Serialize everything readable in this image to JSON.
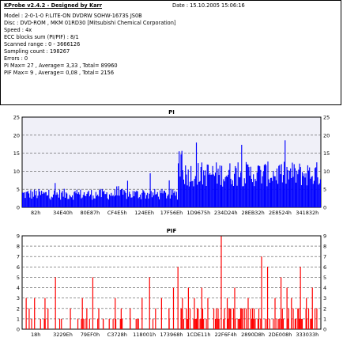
{
  "header": {
    "title": "KProbe v2.4.2 - Designed by Karr",
    "date": "Date : 15.10.2005 15:06:16",
    "lines": [
      "Model : 2-0-1-0 F:LITE-ON DVDRW SOHW-1673S JS0B",
      "Disc : DVD-ROM , MKM 01RD30  [Mitsubishi Chemical Corporation]",
      "Speed : 4x",
      "ECC blocks sum (PI/PIF) : 8/1",
      "Scanned range : 0 - 3666126",
      "Sampling count : 198267",
      "Errors : 0",
      "PI Max= 27 , Average= 3,33 , Total= 89960",
      "PIF Max= 9 , Average= 0,08 , Total= 2156"
    ]
  },
  "chart_data": [
    {
      "type": "bar",
      "title": "PI",
      "color": "#0000ff",
      "background": "#f0f0f8",
      "ylim": [
        0,
        25
      ],
      "y_ticks": [
        0,
        5,
        10,
        15,
        20,
        25
      ],
      "x_tick_labels": [
        "82h",
        "34E40h",
        "80E87h",
        "CF4E5h",
        "124EEh",
        "17F56Eh",
        "1D9675h",
        "234D24h",
        "28EB32h",
        "2E8524h",
        "341832h"
      ],
      "grid": true,
      "max": 27,
      "average": 3.33,
      "profile": [
        {
          "from": 0.0,
          "to": 0.52,
          "baseline": 3.3,
          "spread": 2.2,
          "peak": 9.5
        },
        {
          "from": 0.52,
          "to": 0.54,
          "baseline": 12,
          "spread": 10,
          "peak": 27
        },
        {
          "from": 0.54,
          "to": 1.0,
          "baseline": 8.5,
          "spread": 5,
          "peak": 19
        }
      ]
    },
    {
      "type": "bar",
      "title": "PIF",
      "color": "#ff0000",
      "background": "#ffffff",
      "ylim": [
        0,
        9
      ],
      "y_ticks": [
        0,
        1,
        2,
        3,
        4,
        5,
        6,
        7,
        8,
        9
      ],
      "x_tick_labels": [
        "18h",
        "3229Eh",
        "79EF0h",
        "C3728h",
        "118001h",
        "173968h",
        "1CDE11h",
        "22F6F4h",
        "2890D8h",
        "2DE008h",
        "333033h"
      ],
      "grid": true,
      "max": 9,
      "average": 0.08,
      "spikes": [
        {
          "pos": 0.012,
          "v": 3
        },
        {
          "pos": 0.022,
          "v": 2
        },
        {
          "pos": 0.04,
          "v": 3
        },
        {
          "pos": 0.06,
          "v": 1
        },
        {
          "pos": 0.075,
          "v": 3
        },
        {
          "pos": 0.085,
          "v": 2
        },
        {
          "pos": 0.11,
          "v": 5
        },
        {
          "pos": 0.13,
          "v": 1
        },
        {
          "pos": 0.16,
          "v": 2
        },
        {
          "pos": 0.185,
          "v": 1
        },
        {
          "pos": 0.2,
          "v": 3
        },
        {
          "pos": 0.215,
          "v": 2
        },
        {
          "pos": 0.235,
          "v": 5
        },
        {
          "pos": 0.255,
          "v": 2
        },
        {
          "pos": 0.27,
          "v": 1
        },
        {
          "pos": 0.29,
          "v": 1
        },
        {
          "pos": 0.31,
          "v": 3
        },
        {
          "pos": 0.33,
          "v": 2
        },
        {
          "pos": 0.36,
          "v": 2
        },
        {
          "pos": 0.38,
          "v": 1
        },
        {
          "pos": 0.4,
          "v": 3
        },
        {
          "pos": 0.425,
          "v": 5
        },
        {
          "pos": 0.445,
          "v": 2
        },
        {
          "pos": 0.465,
          "v": 3
        },
        {
          "pos": 0.49,
          "v": 2
        },
        {
          "pos": 0.505,
          "v": 4
        },
        {
          "pos": 0.52,
          "v": 6
        },
        {
          "pos": 0.535,
          "v": 3
        },
        {
          "pos": 0.555,
          "v": 4
        },
        {
          "pos": 0.575,
          "v": 3
        },
        {
          "pos": 0.6,
          "v": 4
        },
        {
          "pos": 0.62,
          "v": 3
        },
        {
          "pos": 0.64,
          "v": 2
        },
        {
          "pos": 0.665,
          "v": 9
        },
        {
          "pos": 0.685,
          "v": 3
        },
        {
          "pos": 0.71,
          "v": 4
        },
        {
          "pos": 0.73,
          "v": 2
        },
        {
          "pos": 0.755,
          "v": 3
        },
        {
          "pos": 0.775,
          "v": 2
        },
        {
          "pos": 0.8,
          "v": 7
        },
        {
          "pos": 0.82,
          "v": 6
        },
        {
          "pos": 0.845,
          "v": 3
        },
        {
          "pos": 0.865,
          "v": 5
        },
        {
          "pos": 0.885,
          "v": 4
        },
        {
          "pos": 0.9,
          "v": 3
        },
        {
          "pos": 0.93,
          "v": 6
        },
        {
          "pos": 0.95,
          "v": 3
        },
        {
          "pos": 0.97,
          "v": 4
        },
        {
          "pos": 0.985,
          "v": 2
        }
      ],
      "dense_region": {
        "from": 0.52,
        "to": 0.98
      }
    }
  ]
}
